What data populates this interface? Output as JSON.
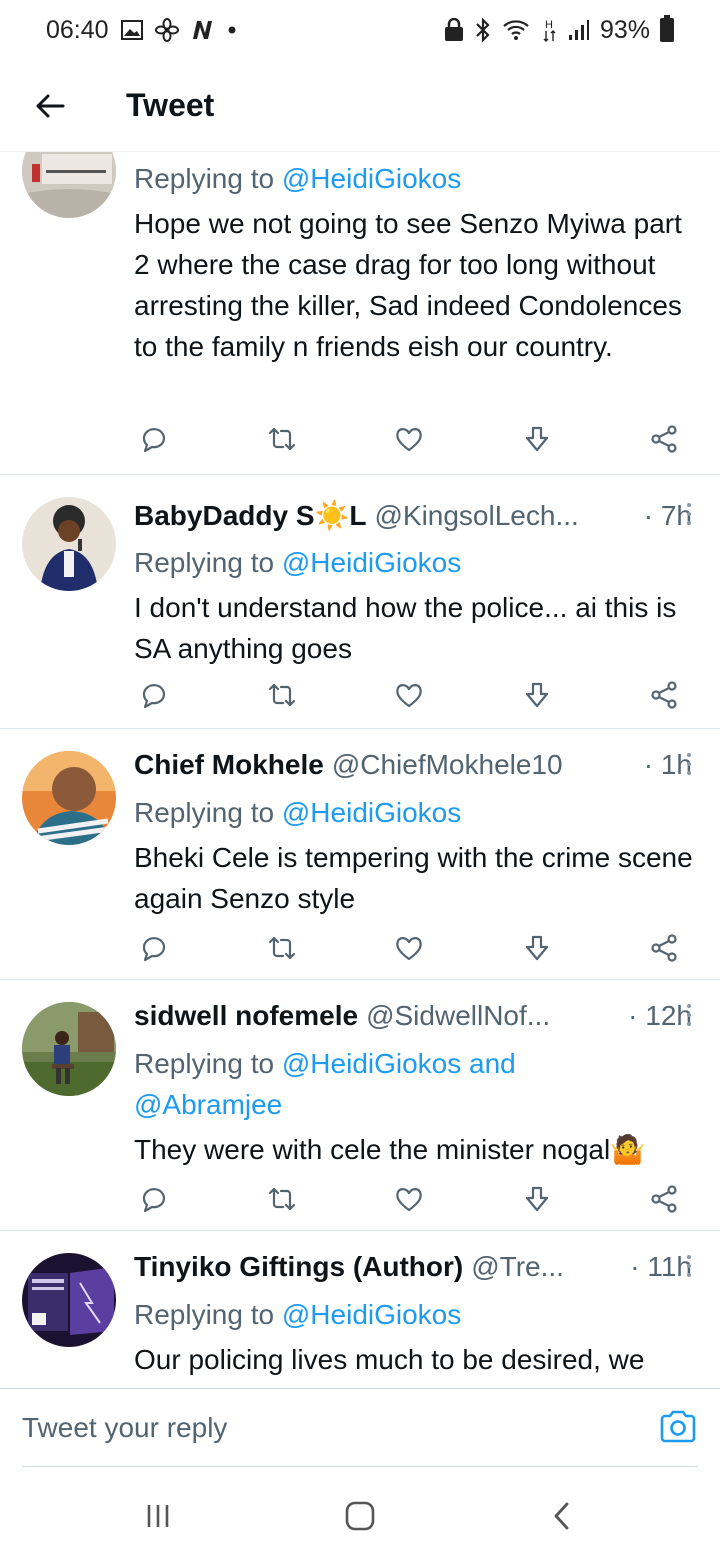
{
  "status_bar": {
    "time": "06:40",
    "battery_percent": "93%",
    "left_icons": [
      "gallery-icon",
      "fan-icon",
      "news-app-icon",
      "dot-icon"
    ],
    "right_icons": [
      "lock-icon",
      "bluetooth-icon",
      "wifi-icon",
      "h-plus-icon",
      "signal-icon",
      "battery-icon"
    ]
  },
  "header": {
    "title": "Tweet",
    "back_icon": "back-arrow-icon"
  },
  "colors": {
    "link": "#1d9bf0",
    "secondary_text": "#536471",
    "primary_text": "#0f1419",
    "action_icon": "#536471"
  },
  "tweets": [
    {
      "name": "",
      "handle": "",
      "time": "",
      "replying_prefix": "Replying to",
      "replying_to": "@HeidiGiokos",
      "text": "Hope we not going to see Senzo Myiwa part 2 where the case drag for too long without arresting the killer, Sad indeed Condolences to the family n friends eish our country."
    },
    {
      "name": "BabyDaddy S☀️L",
      "handle": "@KingsolLech...",
      "time": "· 7h",
      "replying_prefix": "Replying to",
      "replying_to": "@HeidiGiokos",
      "text": "I don't understand how the police... ai this is SA anything goes"
    },
    {
      "name": "Chief Mokhele",
      "handle": "@ChiefMokhele10",
      "time": "· 1h",
      "replying_prefix": "Replying to",
      "replying_to": "@HeidiGiokos",
      "text": "Bheki Cele is tempering with the crime scene again Senzo style"
    },
    {
      "name": "sidwell nofemele",
      "handle": "@SidwellNof...",
      "time": "· 12h",
      "replying_prefix": "Replying to",
      "replying_to": "@HeidiGiokos and",
      "replying_to_2": "@Abramjee",
      "text": "They were with cele the minister nogal🤷"
    },
    {
      "name": "Tinyiko Giftings (Author)",
      "handle": "@Tre...",
      "time": "· 11h",
      "replying_prefix": "Replying to",
      "replying_to": "@HeidiGiokos",
      "text": "Our policing lives much to be desired, we"
    }
  ],
  "actions": [
    "reply-icon",
    "retweet-icon",
    "like-icon",
    "download-icon",
    "share-icon"
  ],
  "reply_bar": {
    "placeholder": "Tweet your reply",
    "camera_icon": "camera-icon"
  },
  "nav_bar": {
    "icons": [
      "recents-icon",
      "home-icon",
      "back-icon"
    ]
  }
}
